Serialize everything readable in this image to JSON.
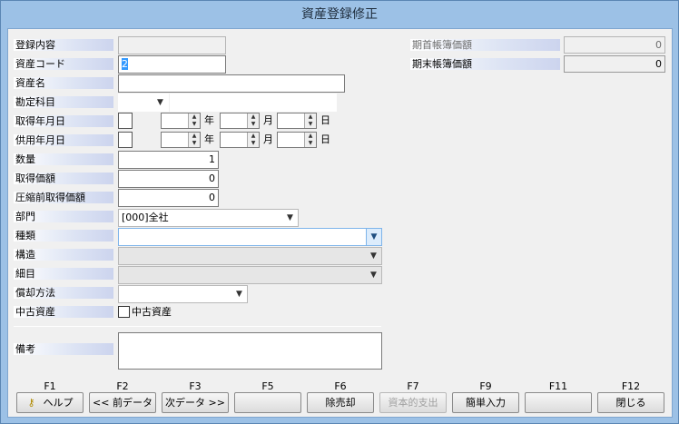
{
  "window": {
    "title": "資産登録修正"
  },
  "labels": {
    "registration_content": "登録内容",
    "asset_code": "資産コード",
    "asset_name": "資産名",
    "account": "勘定科目",
    "acquisition_date": "取得年月日",
    "service_date": "供用年月日",
    "quantity": "数量",
    "acquisition_value": "取得価額",
    "pre_compression_value": "圧縮前取得価額",
    "department": "部門",
    "type": "種類",
    "structure": "構造",
    "detail": "細目",
    "depreciation_method": "償却方法",
    "used_asset": "中古資産",
    "remarks": "備考",
    "opening_book_value": "期首帳簿価額",
    "closing_book_value": "期末帳簿価額",
    "year_unit": "年",
    "month_unit": "月",
    "day_unit": "日"
  },
  "values": {
    "registration_content": "",
    "asset_code": "2",
    "asset_name": "",
    "quantity": "1",
    "acquisition_value": "0",
    "pre_compression_value": "0",
    "department": "[000]全社",
    "opening_book_value": "0",
    "closing_book_value": "0"
  },
  "checkbox": {
    "used_asset_label": "中古資産",
    "used_asset_checked": false
  },
  "function_keys": [
    {
      "key": "F1",
      "label": "ヘルプ",
      "enabled": true
    },
    {
      "key": "F2",
      "label": "<< 前データ",
      "enabled": true
    },
    {
      "key": "F3",
      "label": "次データ >>",
      "enabled": true
    },
    {
      "key": "F5",
      "label": "",
      "enabled": true
    },
    {
      "key": "F6",
      "label": "除売却",
      "enabled": true
    },
    {
      "key": "F7",
      "label": "資本的支出",
      "enabled": false
    },
    {
      "key": "F9",
      "label": "簡単入力",
      "enabled": true
    },
    {
      "key": "F11",
      "label": "",
      "enabled": true
    },
    {
      "key": "F12",
      "label": "閉じる",
      "enabled": true
    }
  ],
  "icons": {
    "help": "help-key-icon",
    "dropdown": "chevron-down-icon"
  }
}
